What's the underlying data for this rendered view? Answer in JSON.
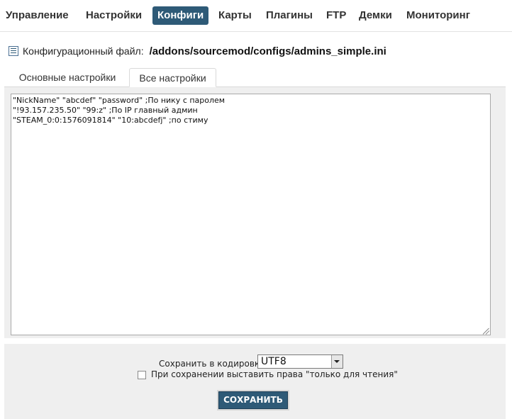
{
  "nav": {
    "items": [
      {
        "label": "Управление"
      },
      {
        "label": "Настройки"
      },
      {
        "label": "Конфиги",
        "active": true
      },
      {
        "label": "Карты"
      },
      {
        "label": "Плагины"
      },
      {
        "label": "FTP"
      },
      {
        "label": "Демки"
      },
      {
        "label": "Мониторинг"
      }
    ]
  },
  "config": {
    "icon": "list-icon",
    "label": "Конфигурационный файл:",
    "path": "/addons/sourcemod/configs/admins_simple.ini"
  },
  "tabs": [
    {
      "label": "Основные настройки",
      "active": false
    },
    {
      "label": "Все настройки",
      "active": true
    }
  ],
  "editor": {
    "lines": [
      "\"NickName\" \"abcdef\" \"password\" ;По нику с паролем",
      "\"!93.157.235.50\" \"99:z\" ;По IP главный админ",
      "\"STEAM_0:0:1576091814\" \"10:abcdefj\" ;по стиму"
    ]
  },
  "save_form": {
    "encoding_label": "Сохранить в кодировке:",
    "encoding_value": "UTF8",
    "readonly_label": "При сохранении выставить права \"только для чтения\"",
    "readonly_checked": false,
    "save_button": "СОХРАНИТЬ"
  },
  "colors": {
    "accent": "#2e5a77",
    "panel": "#efefef"
  }
}
